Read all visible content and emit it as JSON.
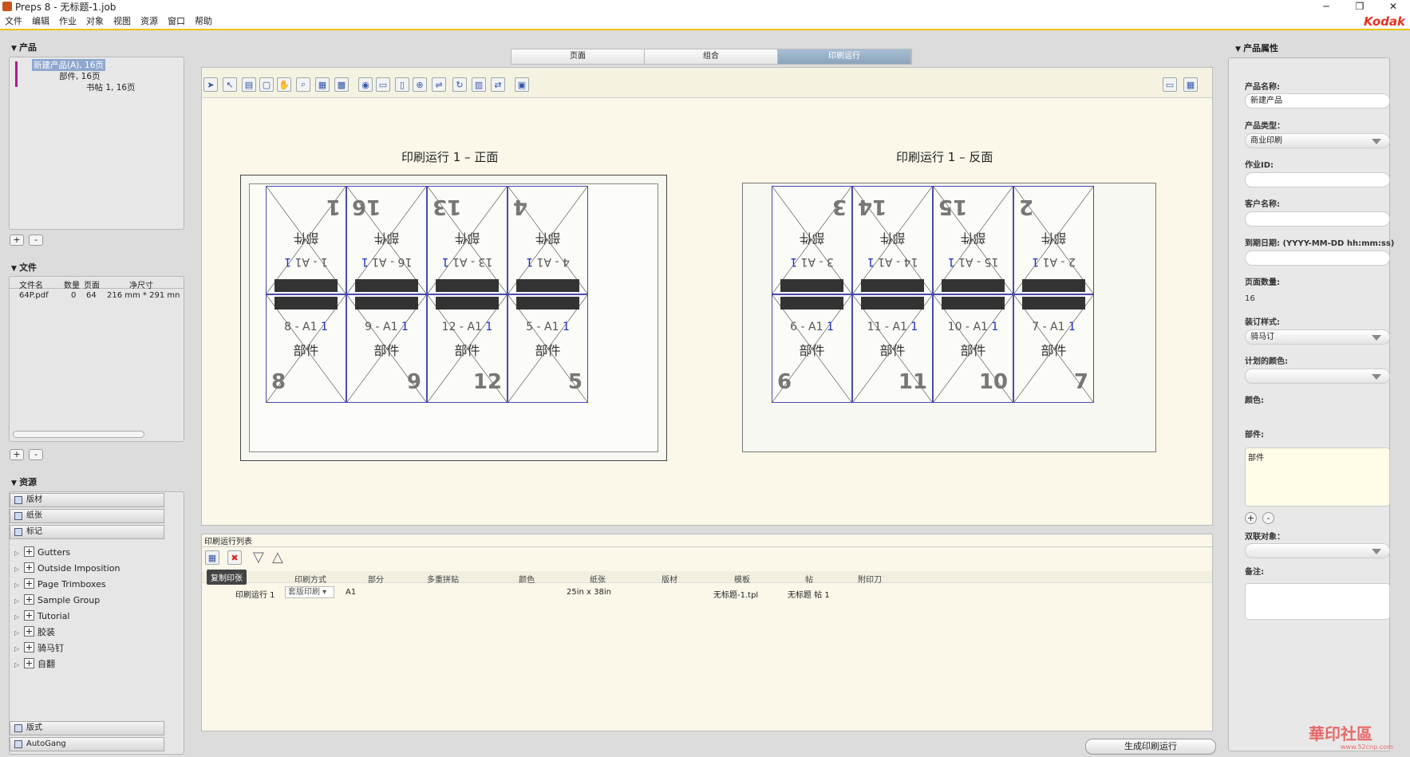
{
  "window": {
    "title": "Preps 8 - 无标题-1.job",
    "minimize": "─",
    "restore": "❐",
    "close": "✕"
  },
  "menu": [
    "文件",
    "编辑",
    "作业",
    "对象",
    "视图",
    "资源",
    "窗口",
    "帮助"
  ],
  "brand": "Kodak",
  "product_panel": {
    "title": "产品",
    "tree": [
      {
        "label": "新建产品(A), 16页"
      },
      {
        "label": "部件, 16页"
      },
      {
        "label": "书帖 1, 16页"
      }
    ],
    "add": "+",
    "remove": "-"
  },
  "files_panel": {
    "title": "文件",
    "columns": [
      "文件名",
      "数量",
      "页面",
      "净尺寸"
    ],
    "rows": [
      {
        "name": "64P.pdf",
        "qty": "0",
        "pages": "64",
        "size": "216 mm * 291 mn"
      }
    ],
    "add": "+",
    "remove": "-"
  },
  "resources_panel": {
    "title": "资源",
    "groups": [
      "版材",
      "纸张",
      "标记"
    ],
    "items": [
      "Gutters",
      "Outside Imposition",
      "Page Trimboxes",
      "Sample Group",
      "Tutorial",
      "胶装",
      "骑马钉",
      "自翻"
    ],
    "footer": [
      "版式",
      "AutoGang"
    ]
  },
  "tabs": [
    {
      "label": "页面",
      "active": false
    },
    {
      "label": "组合",
      "active": false
    },
    {
      "label": "印刷运行",
      "active": true
    }
  ],
  "toolbar_icons": [
    "select-arrow-icon",
    "direct-select-icon",
    "page-icon",
    "page-frame-icon",
    "hand-icon",
    "zoom-icon",
    "grid-icon",
    "color-icon",
    "eye-icon",
    "ruler-icon",
    "page-size-icon",
    "crosshair-icon",
    "align-icon",
    "rotate-icon",
    "layout-icon",
    "swap-icon",
    "monitor-icon"
  ],
  "sheets": [
    {
      "title": "印刷运行 1 – 正面",
      "top": [
        {
          "num": "1",
          "label": "部件",
          "fold": "1 - A1",
          "mark": "1"
        },
        {
          "num": "16",
          "label": "部件",
          "fold": "16 - A1",
          "mark": "1"
        },
        {
          "num": "13",
          "label": "部件",
          "fold": "13 - A1",
          "mark": "1"
        },
        {
          "num": "4",
          "label": "部件",
          "fold": "4 - A1",
          "mark": "1"
        }
      ],
      "bottom": [
        {
          "num": "8",
          "label": "部件",
          "fold": "8 - A1",
          "mark": "1"
        },
        {
          "num": "9",
          "label": "部件",
          "fold": "9 - A1",
          "mark": "1"
        },
        {
          "num": "12",
          "label": "部件",
          "fold": "12 - A1",
          "mark": "1"
        },
        {
          "num": "5",
          "label": "部件",
          "fold": "5 - A1",
          "mark": "1"
        }
      ]
    },
    {
      "title": "印刷运行 1 – 反面",
      "top": [
        {
          "num": "3",
          "label": "部件",
          "fold": "3 - A1",
          "mark": "1"
        },
        {
          "num": "14",
          "label": "部件",
          "fold": "14 - A1",
          "mark": "1"
        },
        {
          "num": "15",
          "label": "部件",
          "fold": "15 - A1",
          "mark": "1"
        },
        {
          "num": "2",
          "label": "部件",
          "fold": "2 - A1",
          "mark": "1"
        }
      ],
      "bottom": [
        {
          "num": "6",
          "label": "部件",
          "fold": "6 - A1",
          "mark": "1"
        },
        {
          "num": "11",
          "label": "部件",
          "fold": "11 - A1",
          "mark": "1"
        },
        {
          "num": "10",
          "label": "部件",
          "fold": "10 - A1",
          "mark": "1"
        },
        {
          "num": "7",
          "label": "部件",
          "fold": "7 - A1",
          "mark": "1"
        }
      ]
    }
  ],
  "runlist": {
    "title": "印刷运行列表",
    "tooltip": "复制印张",
    "columns": [
      "印刷方式",
      "部分",
      "多重拼贴",
      "颜色",
      "纸张",
      "版材",
      "模板",
      "帖",
      "附印刀"
    ],
    "row": {
      "name": "印刷运行 1",
      "method": "套版印刷",
      "part": "A1",
      "paper": "25in x 38in",
      "template": "无标题-1.tpl",
      "signature": "无标题 帖 1"
    },
    "generate_button": "生成印刷运行"
  },
  "properties": {
    "title": "产品属性",
    "fields": [
      {
        "label": "产品名称:",
        "value": "新建产品",
        "kind": "input"
      },
      {
        "label": "产品类型：",
        "value": "商业印刷",
        "kind": "select"
      },
      {
        "label": "作业ID:",
        "value": "",
        "kind": "input"
      },
      {
        "label": "客户名称:",
        "value": "",
        "kind": "input"
      },
      {
        "label": "到期日期: (YYYY-MM-DD hh:mm:ss)",
        "value": "",
        "kind": "input"
      },
      {
        "label": "页面数量:",
        "value": "16",
        "kind": "text"
      },
      {
        "label": "装订样式:",
        "value": "骑马订",
        "kind": "select"
      },
      {
        "label": "计划的颜色:",
        "value": "",
        "kind": "select"
      },
      {
        "label": "颜色:",
        "value": "",
        "kind": "none"
      }
    ],
    "parts_label": "部件:",
    "parts_value": "部件",
    "linked_label": "双联对象：",
    "notes_label": "备注:",
    "add": "+",
    "remove": "-"
  },
  "watermark": {
    "name": "華印社區",
    "url": "www.52cnp.com"
  }
}
